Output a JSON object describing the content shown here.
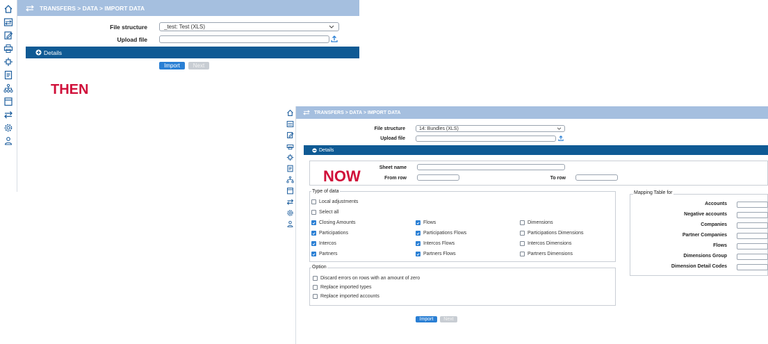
{
  "then": {
    "breadcrumb": "TRANSFERS > DATA > IMPORT DATA",
    "file_structure_label": "File structure",
    "file_structure_value": "_test: Test (XLS)",
    "upload_file_label": "Upload file",
    "details_label": "Details",
    "import_label": "Import",
    "next_label": "Next",
    "caption": "THEN"
  },
  "now": {
    "breadcrumb": "TRANSFERS > DATA > IMPORT DATA",
    "file_structure_label": "File structure",
    "file_structure_value": "14: Bundles (XLS)",
    "upload_file_label": "Upload file",
    "details_label": "Details",
    "sheet_name_label": "Sheet name",
    "from_row_label": "From row",
    "to_row_label": "To row",
    "caption": "NOW",
    "type_of_data": {
      "title": "Type of data",
      "local_adjustments": {
        "label": "Local adjustments",
        "checked": false
      },
      "select_all": {
        "label": "Select all",
        "checked": false
      },
      "grid": [
        [
          {
            "label": "Closing Amounts",
            "checked": true
          },
          {
            "label": "Flows",
            "checked": true
          },
          {
            "label": "Dimensions",
            "checked": false
          }
        ],
        [
          {
            "label": "Participations",
            "checked": true
          },
          {
            "label": "Participations Flows",
            "checked": true
          },
          {
            "label": "Participations Dimensions",
            "checked": false
          }
        ],
        [
          {
            "label": "Intercos",
            "checked": true
          },
          {
            "label": "Intercos Flows",
            "checked": true
          },
          {
            "label": "Intercos Dimensions",
            "checked": false
          }
        ],
        [
          {
            "label": "Partners",
            "checked": true
          },
          {
            "label": "Partners Flows",
            "checked": true
          },
          {
            "label": "Partners Dimensions",
            "checked": false
          }
        ]
      ]
    },
    "option": {
      "title": "Option",
      "items": [
        {
          "label": "Discard errors on rows with an amount of zero",
          "checked": false
        },
        {
          "label": "Replace imported types",
          "checked": false
        },
        {
          "label": "Replace imported accounts",
          "checked": false
        }
      ]
    },
    "mapping": {
      "title": "Mapping Table for",
      "rows": [
        "Accounts",
        "Negative accounts",
        "Companies",
        "Partner Companies",
        "Flows",
        "Dimensions Group",
        "Dimension Detail Codes"
      ]
    },
    "import_label": "Import",
    "next_label": "Next"
  },
  "sidebar_icons": [
    "home-icon",
    "transfer-board-icon",
    "edit-form-icon",
    "printer-icon",
    "network-icon",
    "document-list-icon",
    "hierarchy-icon",
    "calendar-icon",
    "transfers-icon",
    "settings-gear-icon",
    "user-group-icon"
  ],
  "colors": {
    "header": "#a5bfdf",
    "details_bar": "#0f5a94",
    "primary_button": "#2a7fd4",
    "caption_red": "#d0103a"
  }
}
